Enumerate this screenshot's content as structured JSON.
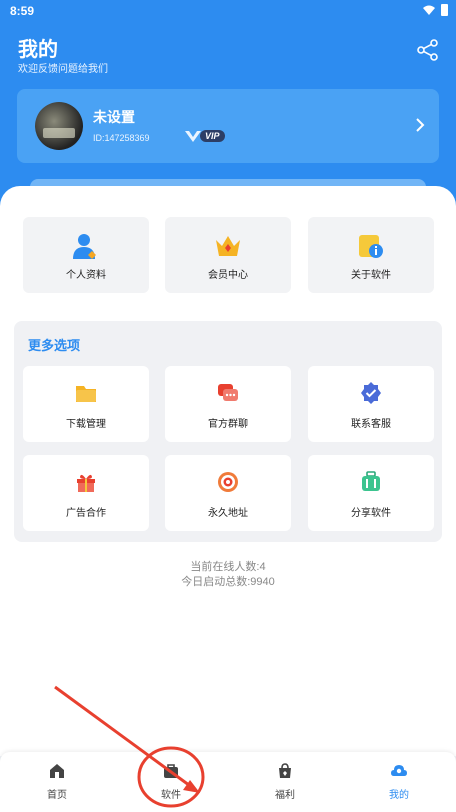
{
  "status_bar": {
    "time": "8:59"
  },
  "header": {
    "title": "我的",
    "subtitle": "欢迎反馈问题给我们"
  },
  "icons": {
    "share": "share-icon",
    "vip": "vip-diamond-icon",
    "chevron": "chevron-right-icon",
    "wifi": "wifi-icon",
    "battery": "battery-icon"
  },
  "user": {
    "name": "未设置",
    "id": "ID:147258369",
    "vip_label": "VIP"
  },
  "quick_actions": [
    {
      "label": "个人资料",
      "icon": "user-profile-icon"
    },
    {
      "label": "会员中心",
      "icon": "crown-icon"
    },
    {
      "label": "关于软件",
      "icon": "info-folder-icon"
    }
  ],
  "more": {
    "title": "更多选项",
    "items": [
      {
        "label": "下载管理",
        "icon": "folder-icon"
      },
      {
        "label": "官方群聊",
        "icon": "chat-icon"
      },
      {
        "label": "联系客服",
        "icon": "badge-check-icon"
      },
      {
        "label": "广告合作",
        "icon": "gift-icon"
      },
      {
        "label": "永久地址",
        "icon": "target-icon"
      },
      {
        "label": "分享软件",
        "icon": "suitcase-icon"
      }
    ]
  },
  "stats": {
    "online": "当前在线人数:4",
    "launches": "今日启动总数:9940"
  },
  "tabs": [
    {
      "label": "首页",
      "icon": "home-icon"
    },
    {
      "label": "软件",
      "icon": "apps-bag-icon"
    },
    {
      "label": "福利",
      "icon": "shopping-bag-icon"
    },
    {
      "label": "我的",
      "icon": "profile-cloud-icon"
    }
  ],
  "colors": {
    "primary": "#2d8cf0",
    "card": "#4aa2f4",
    "annotation": "#e8402f"
  }
}
